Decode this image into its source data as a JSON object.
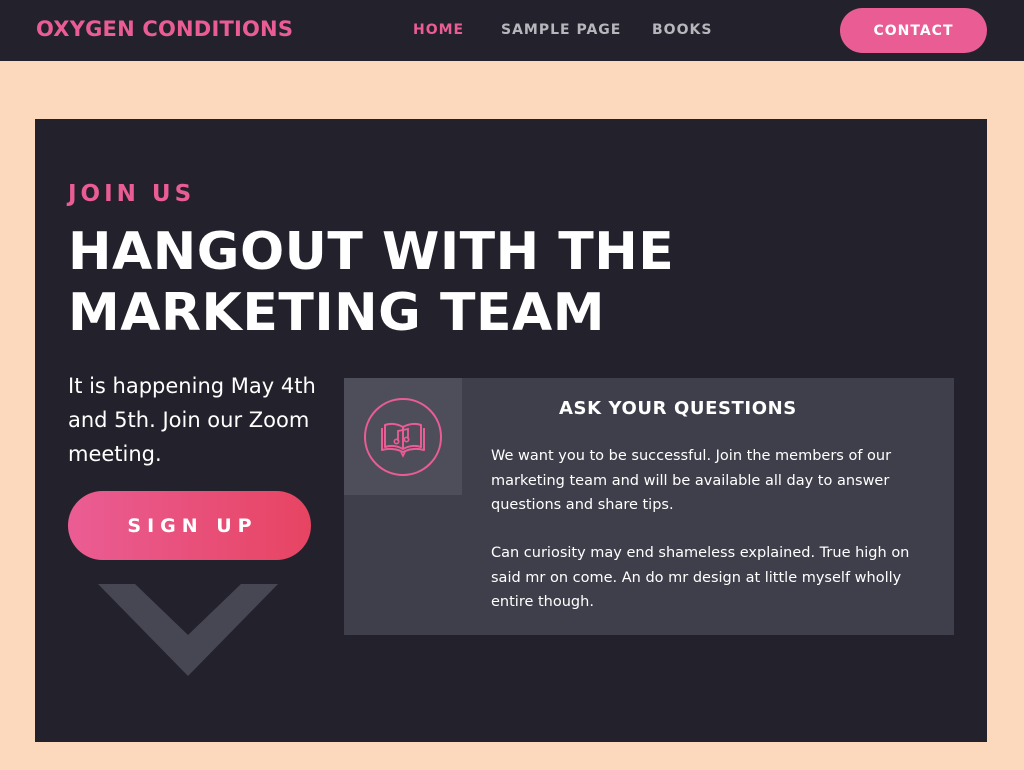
{
  "header": {
    "brand": "OXYGEN CONDITIONS",
    "nav": [
      {
        "label": "HOME",
        "active": true
      },
      {
        "label": "SAMPLE PAGE",
        "active": false
      },
      {
        "label": "BOOKS",
        "active": false
      }
    ],
    "contact_label": "CONTACT"
  },
  "hero": {
    "kicker": "JOIN US",
    "headline_line1": "HANGOUT WITH THE",
    "headline_line2": "MARKETING TEAM",
    "intro": "It is happening May 4th and 5th.  Join our Zoom meeting.",
    "signup_label": "SIGN UP",
    "decor_icon": "chevron-down-icon"
  },
  "card": {
    "icon": "music-book-icon",
    "title": "ASK YOUR QUESTIONS",
    "paragraph1": "We want you to be successful.  Join the members of our marketing team and will be available all day to answer questions and share tips.",
    "paragraph2": "Can curiosity may end shameless explained. True high on said mr on come. An do mr design at little myself wholly entire though."
  },
  "colors": {
    "accent": "#ea5d94",
    "accent_end": "#e74462",
    "dark": "#23222c",
    "card": "#3f3f4b",
    "page_bg": "#fcd8bd"
  }
}
